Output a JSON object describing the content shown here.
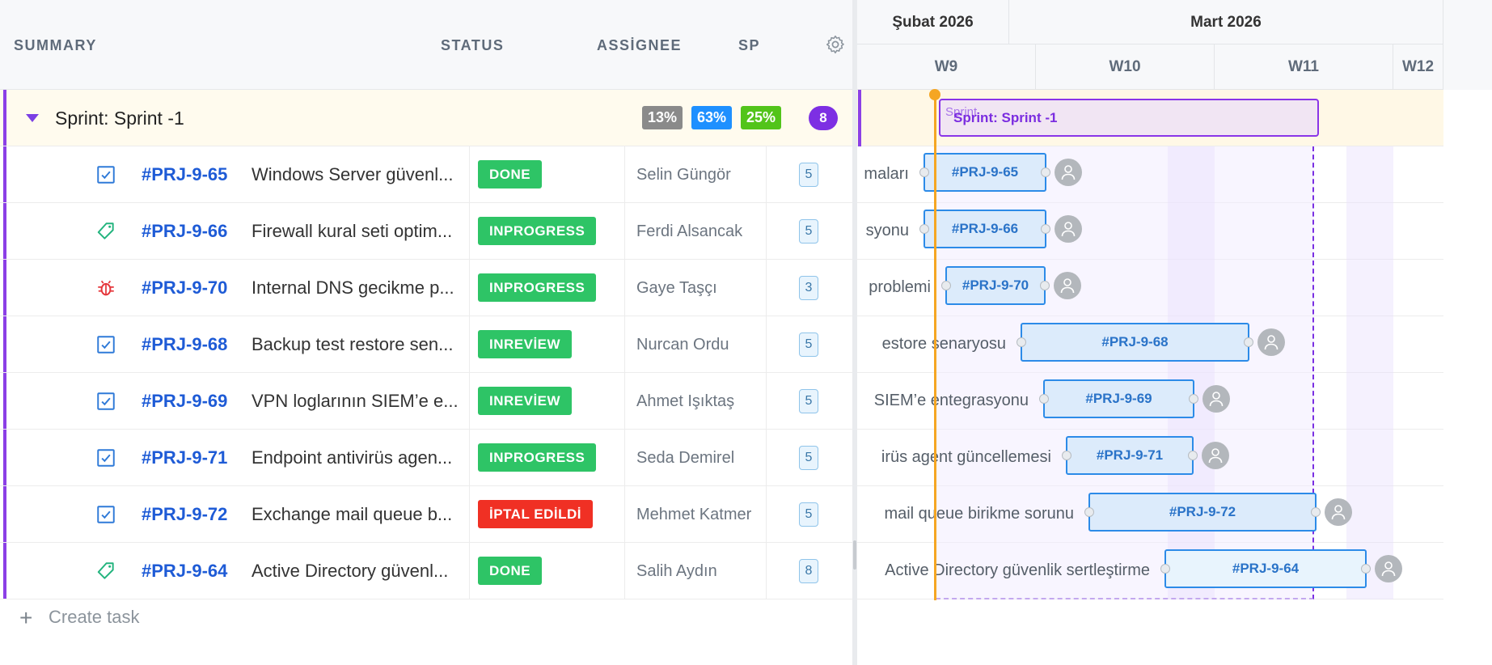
{
  "colors": {
    "sprint_accent": "#7d2fe3",
    "key_blue": "#1e5bd6",
    "status_done": "#2ec466",
    "status_inprogress": "#2ec466",
    "status_inreview": "#2ec466",
    "status_cancelled": "#f03024",
    "today_line": "#f5a623",
    "gantt_bar": "#2c8be8"
  },
  "grid": {
    "headers": {
      "summary": "SUMMARY",
      "status": "STATUS",
      "assignee": "ASSİGNEE",
      "sp": "SP"
    },
    "settings_icon": "gear-icon",
    "sprint": {
      "title": "Sprint: Sprint -1",
      "pct_todo": "13%",
      "pct_inprogress": "63%",
      "pct_done": "25%",
      "count": "8"
    },
    "tasks": [
      {
        "icon": "checkbox-task-icon",
        "key": "#PRJ-9-65",
        "summary": "Windows Server güvenl...",
        "status": "DONE",
        "assignee": "Selin Güngör",
        "sp": "5"
      },
      {
        "icon": "tag-story-icon",
        "key": "#PRJ-9-66",
        "summary": "Firewall kural seti optim...",
        "status": "INPROGRESS",
        "assignee": "Ferdi Alsancak",
        "sp": "5"
      },
      {
        "icon": "bug-icon",
        "key": "#PRJ-9-70",
        "summary": "Internal DNS gecikme p...",
        "status": "INPROGRESS",
        "assignee": "Gaye Taşçı",
        "sp": "3"
      },
      {
        "icon": "checkbox-task-icon",
        "key": "#PRJ-9-68",
        "summary": "Backup test restore sen...",
        "status": "INREVİEW",
        "assignee": "Nurcan Ordu",
        "sp": "5"
      },
      {
        "icon": "checkbox-task-icon",
        "key": "#PRJ-9-69",
        "summary": "VPN loglarının SIEM’e e...",
        "status": "INREVİEW",
        "assignee": "Ahmet Işıktaş",
        "sp": "5"
      },
      {
        "icon": "checkbox-task-icon",
        "key": "#PRJ-9-71",
        "summary": "Endpoint antivirüs agen...",
        "status": "INPROGRESS",
        "assignee": "Seda Demirel",
        "sp": "5"
      },
      {
        "icon": "checkbox-task-icon",
        "key": "#PRJ-9-72",
        "summary": "Exchange mail queue b...",
        "status": "İPTAL EDİLDİ",
        "assignee": "Mehmet Katmer",
        "sp": "5"
      },
      {
        "icon": "tag-story-icon",
        "key": "#PRJ-9-64",
        "summary": "Active Directory güvenl...",
        "status": "DONE",
        "assignee": "Salih Aydın",
        "sp": "8"
      }
    ],
    "create_task": "Create task"
  },
  "gantt": {
    "months": [
      "Şubat 2026",
      "Mart 2026"
    ],
    "weeks": [
      "W9",
      "W10",
      "W11",
      "W12"
    ],
    "sprint_bar_label": "Sprint: Sprint -1",
    "sprint_bar_ghost": "Sprint",
    "bars": [
      {
        "trail": "maları",
        "key": "#PRJ-9-65"
      },
      {
        "trail": "syonu",
        "key": "#PRJ-9-66"
      },
      {
        "trail": " problemi",
        "key": "#PRJ-9-70"
      },
      {
        "trail": "estore senaryosu",
        "key": "#PRJ-9-68"
      },
      {
        "trail": "SIEM’e entegrasyonu",
        "key": "#PRJ-9-69"
      },
      {
        "trail": "irüs agent güncellemesi",
        "key": "#PRJ-9-71"
      },
      {
        "trail": " mail queue birikme sorunu",
        "key": "#PRJ-9-72"
      },
      {
        "trail": "Active Directory güvenlik sertleştirme",
        "key": "#PRJ-9-64"
      }
    ]
  }
}
